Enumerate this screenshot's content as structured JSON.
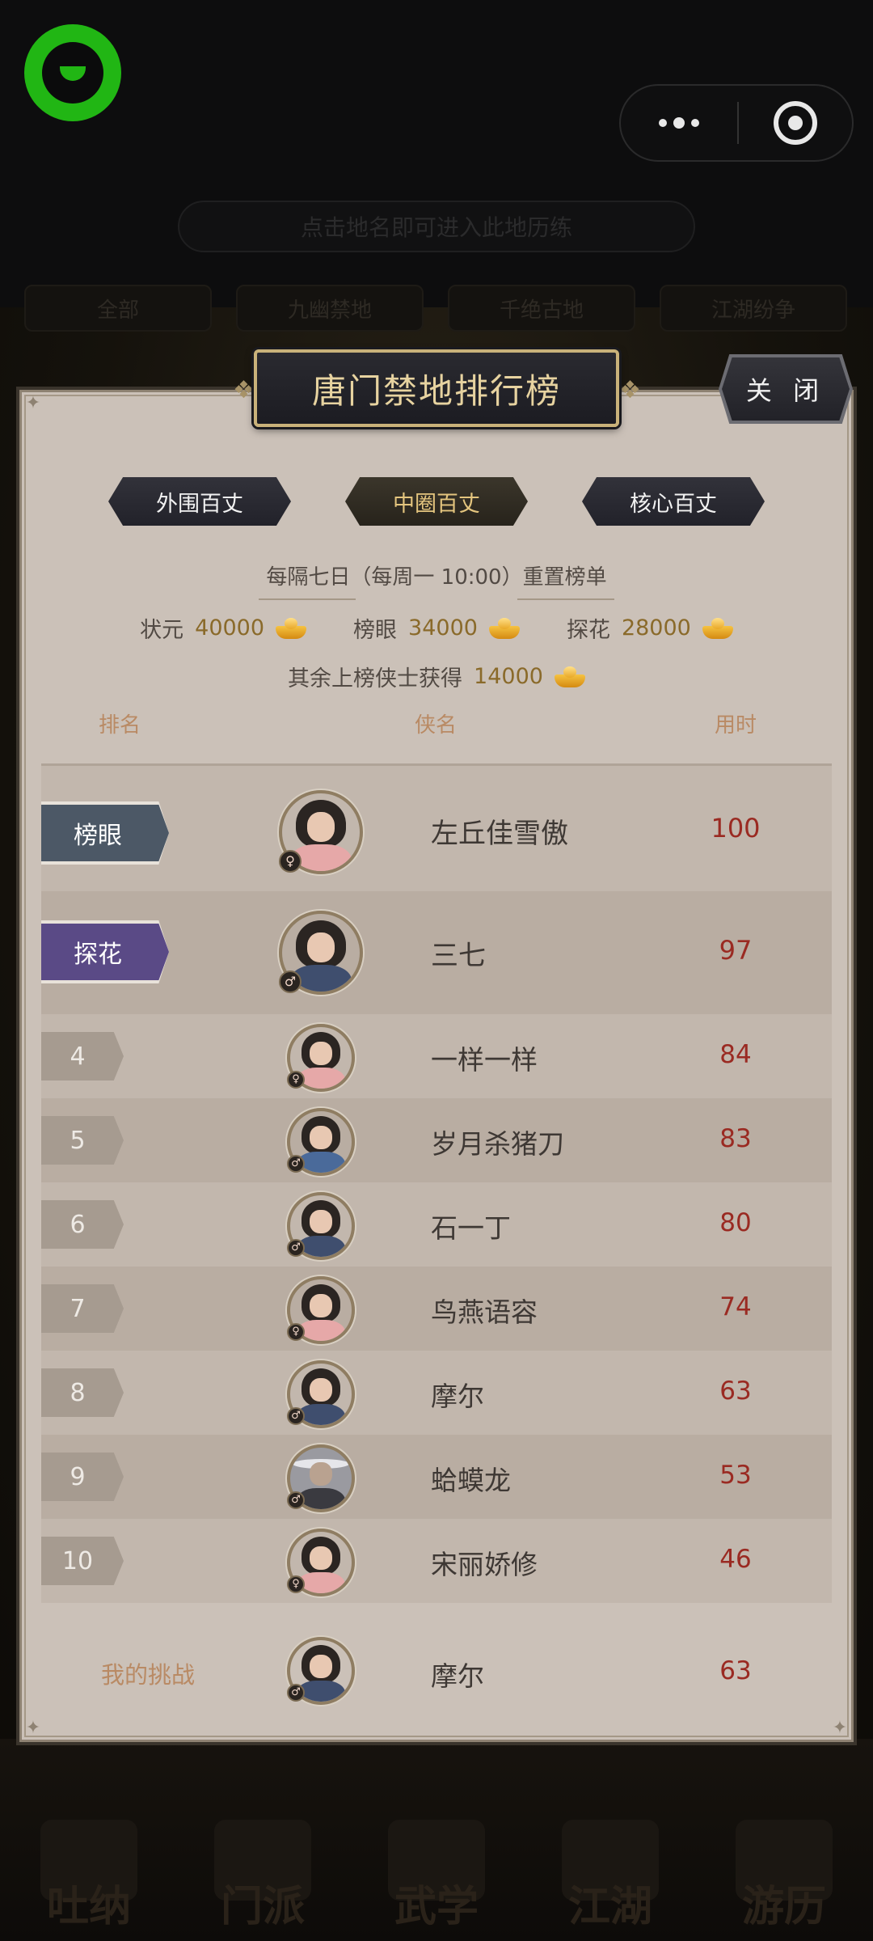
{
  "background": {
    "hint": "点击地名即可进入此地历练",
    "area_tabs": [
      "全部",
      "九幽禁地",
      "千绝古地",
      "江湖纷争"
    ],
    "bottom_nav": [
      "吐纳",
      "门派",
      "武学",
      "江湖",
      "游历"
    ]
  },
  "dialog": {
    "title": "唐门禁地排行榜",
    "close_label": "关 闭",
    "tabs": [
      {
        "label": "外围百丈",
        "active": false
      },
      {
        "label": "中圈百丈",
        "active": true
      },
      {
        "label": "核心百丈",
        "active": false
      }
    ],
    "reset_text": "每隔七日（每周一 10:00）重置榜单",
    "rewards": [
      {
        "label": "状元",
        "amount": "40000",
        "icon": "gold-ingot-icon"
      },
      {
        "label": "榜眼",
        "amount": "34000",
        "icon": "gold-ingot-icon"
      },
      {
        "label": "探花",
        "amount": "28000",
        "icon": "gold-ingot-icon"
      }
    ],
    "rest_reward": {
      "label": "其余上榜侠士获得",
      "amount": "14000",
      "icon": "gold-ingot-icon"
    },
    "columns": {
      "rank": "排名",
      "name": "侠名",
      "time": "用时"
    },
    "rows": [
      {
        "rank": "榜眼",
        "name": "左丘佳雪傲",
        "time": "100",
        "gender": "female",
        "badge_color": "#4c5866"
      },
      {
        "rank": "探花",
        "name": "三七",
        "time": "97",
        "gender": "male",
        "badge_color": "#5a4a86"
      },
      {
        "rank": "4",
        "name": "一样一样",
        "time": "84",
        "gender": "female"
      },
      {
        "rank": "5",
        "name": "岁月杀猪刀",
        "time": "83",
        "gender": "male"
      },
      {
        "rank": "6",
        "name": "石一丁",
        "time": "80",
        "gender": "male"
      },
      {
        "rank": "7",
        "name": "鸟燕语容",
        "time": "74",
        "gender": "female"
      },
      {
        "rank": "8",
        "name": "摩尔",
        "time": "63",
        "gender": "male"
      },
      {
        "rank": "9",
        "name": "蛤蟆龙",
        "time": "53",
        "gender": "male",
        "hat": true
      },
      {
        "rank": "10",
        "name": "宋丽娇修",
        "time": "46",
        "gender": "female"
      }
    ],
    "my_challenge": {
      "label": "我的挑战",
      "name": "摩尔",
      "time": "63",
      "gender": "male"
    }
  },
  "colors": {
    "panel": "#cbc1b8",
    "time_red": "#9a2a22",
    "header_brown": "#b98a64",
    "gold_text": "#e7d3a0",
    "miniapp_green": "#21b614"
  }
}
